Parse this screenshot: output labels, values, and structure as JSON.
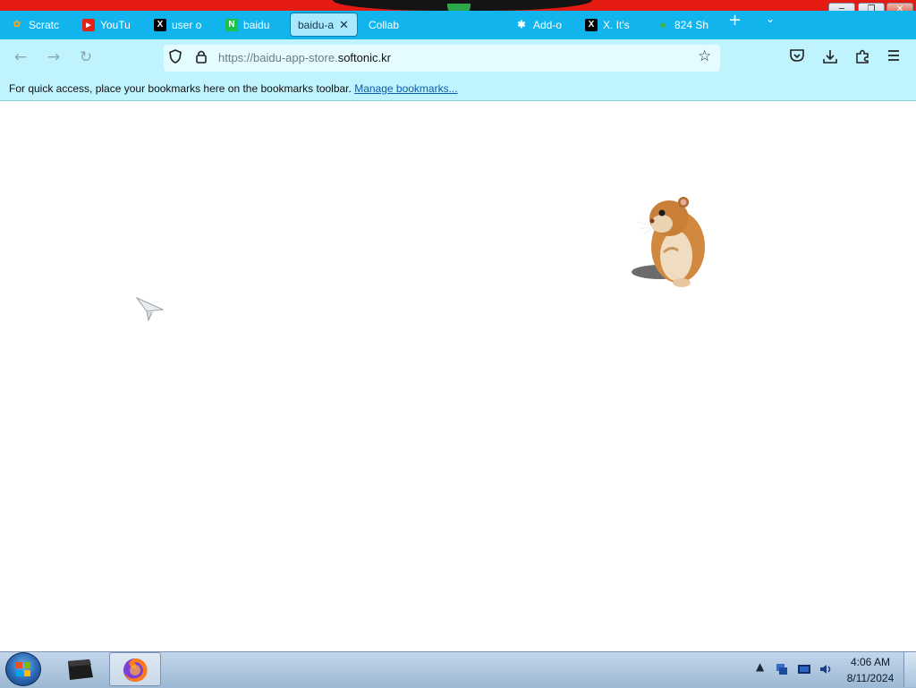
{
  "window": {
    "controls": [
      "minimize",
      "maximize",
      "close"
    ]
  },
  "tabs": [
    {
      "label": "Scratc",
      "icon": "scratch-icon",
      "color": "#f5a623"
    },
    {
      "label": "YouTu",
      "icon": "youtube-icon",
      "color": "#e62117"
    },
    {
      "label": "user o",
      "icon": "x-icon",
      "color": "#000000"
    },
    {
      "label": "baidu",
      "icon": "naver-icon",
      "color": "#19c24a"
    },
    {
      "label": "baidu-a",
      "icon": "globe-icon",
      "color": "#12b4ee",
      "active": true
    },
    {
      "label": "Collab",
      "icon": "none",
      "color": "#12b4ee"
    },
    {
      "label": "Add-o",
      "icon": "puzzle-icon",
      "color": "#12b4ee"
    },
    {
      "label": "X. It's",
      "icon": "x-icon",
      "color": "#000000"
    },
    {
      "label": "824 Sh",
      "icon": "leaf-icon",
      "color": "#3db34a"
    }
  ],
  "toolbar": {
    "back": "back-arrow-icon",
    "forward": "forward-arrow-icon",
    "reload": "reload-icon",
    "url_prefix": "https://baidu-app-store.",
    "url_domain": "softonic.kr",
    "tools": [
      "pocket-icon",
      "download-icon",
      "extensions-icon",
      "menu-icon"
    ]
  },
  "bookmarks": {
    "message": "For quick access, place your bookmarks here on the bookmarks toolbar.",
    "link": "Manage bookmarks..."
  },
  "taskbar": {
    "time": "4:06 AM",
    "date": "8/11/2024"
  },
  "colors": {
    "tabstrip": "#12b4ee",
    "navbar": "#bff4ff",
    "topstrip": "#e41b12"
  }
}
